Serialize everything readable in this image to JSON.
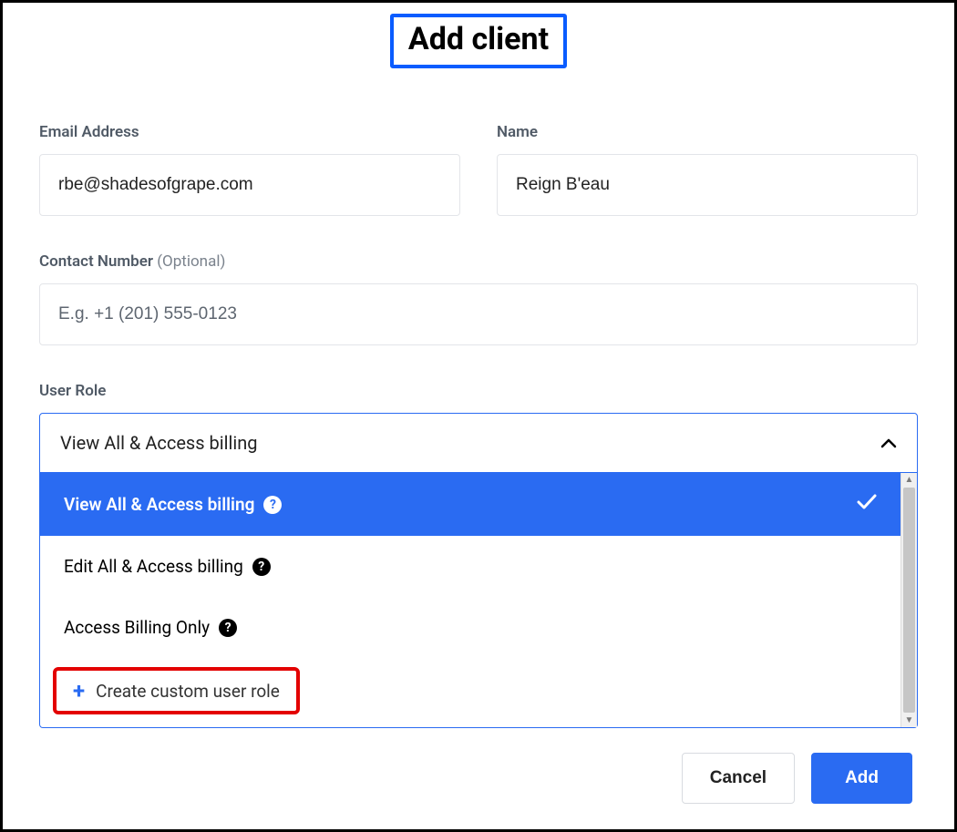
{
  "header": {
    "title": "Add client"
  },
  "fields": {
    "email": {
      "label": "Email Address",
      "value": "rbe@shadesofgrape.com"
    },
    "name": {
      "label": "Name",
      "value": "Reign B'eau"
    },
    "contact": {
      "label": "Contact Number",
      "optional_suffix": "(Optional)",
      "placeholder": "E.g. +1 (201) 555-0123",
      "value": ""
    },
    "role": {
      "label": "User Role",
      "selected": "View All & Access billing",
      "options": [
        {
          "label": "View All & Access billing",
          "selected": true
        },
        {
          "label": "Edit All & Access billing",
          "selected": false
        },
        {
          "label": "Access Billing Only",
          "selected": false
        }
      ],
      "create_label": "Create custom user role"
    }
  },
  "actions": {
    "cancel": "Cancel",
    "add": "Add"
  }
}
